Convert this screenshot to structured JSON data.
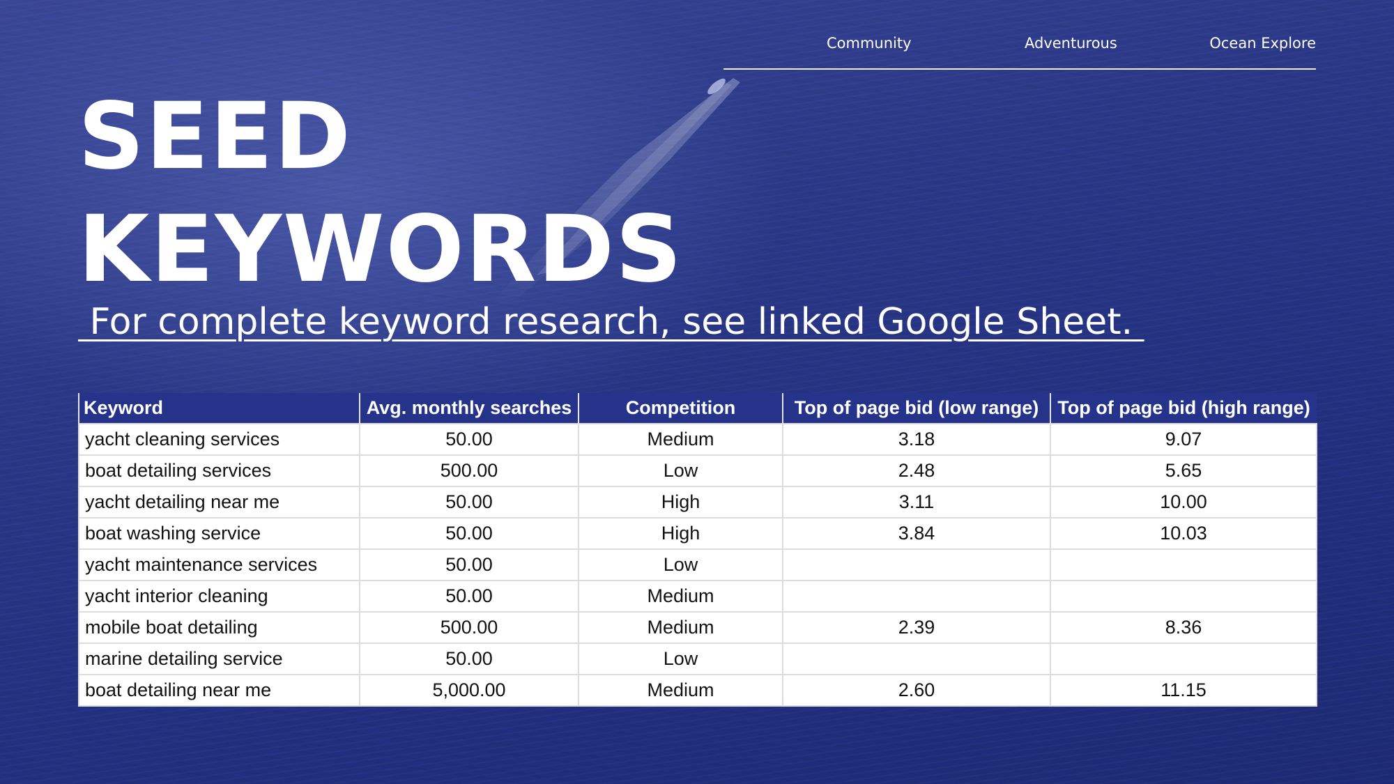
{
  "nav": {
    "items": [
      "Community",
      "Adventurous",
      "Ocean Explore"
    ]
  },
  "heading": {
    "line1": "SEED",
    "line2": "KEYWORDS"
  },
  "subtitle": {
    "text": " For complete keyword research, see linked Google Sheet. "
  },
  "table": {
    "headers": [
      "Keyword",
      "Avg. monthly searches",
      "Competition",
      "Top of page bid (low range)",
      "Top of page bid (high range)"
    ],
    "rows": [
      [
        "yacht cleaning services",
        "50.00",
        "Medium",
        "3.18",
        "9.07"
      ],
      [
        "boat detailing services",
        "500.00",
        "Low",
        "2.48",
        "5.65"
      ],
      [
        "yacht detailing near me",
        "50.00",
        "High",
        "3.11",
        "10.00"
      ],
      [
        "boat washing service",
        "50.00",
        "High",
        "3.84",
        "10.03"
      ],
      [
        "yacht maintenance services",
        "50.00",
        "Low",
        "",
        ""
      ],
      [
        "yacht interior cleaning",
        "50.00",
        "Medium",
        "",
        ""
      ],
      [
        "mobile boat detailing",
        "500.00",
        "Medium",
        "2.39",
        "8.36"
      ],
      [
        "marine detailing service",
        "50.00",
        "Low",
        "",
        ""
      ],
      [
        "boat detailing near me",
        "5,000.00",
        "Medium",
        "2.60",
        "11.15"
      ]
    ]
  },
  "colors": {
    "background": "#2a3887",
    "header_row": "#26338a",
    "text": "#ffffff"
  }
}
